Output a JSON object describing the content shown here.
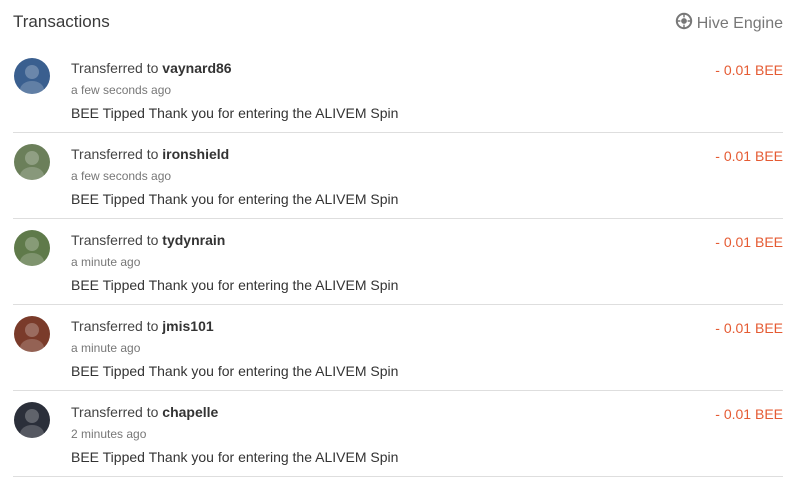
{
  "header": {
    "title": "Transactions",
    "engine_label": "Hive Engine"
  },
  "transactions": [
    {
      "action": "Transferred to",
      "user": "vaynard86",
      "time": "a few seconds ago",
      "memo": "BEE Tipped Thank you for entering the ALIVEM Spin",
      "amount": "- 0.01 BEE",
      "avatar_color": "#3a5f8f"
    },
    {
      "action": "Transferred to",
      "user": "ironshield",
      "time": "a few seconds ago",
      "memo": "BEE Tipped Thank you for entering the ALIVEM Spin",
      "amount": "- 0.01 BEE",
      "avatar_color": "#6b7f5a"
    },
    {
      "action": "Transferred to",
      "user": "tydynrain",
      "time": "a minute ago",
      "memo": "BEE Tipped Thank you for entering the ALIVEM Spin",
      "amount": "- 0.01 BEE",
      "avatar_color": "#5f7a4a"
    },
    {
      "action": "Transferred to",
      "user": "jmis101",
      "time": "a minute ago",
      "memo": "BEE Tipped Thank you for entering the ALIVEM Spin",
      "amount": "- 0.01 BEE",
      "avatar_color": "#7a3b2a"
    },
    {
      "action": "Transferred to",
      "user": "chapelle",
      "time": "2 minutes ago",
      "memo": "BEE Tipped Thank you for entering the ALIVEM Spin",
      "amount": "- 0.01 BEE",
      "avatar_color": "#2b2f3a"
    }
  ]
}
